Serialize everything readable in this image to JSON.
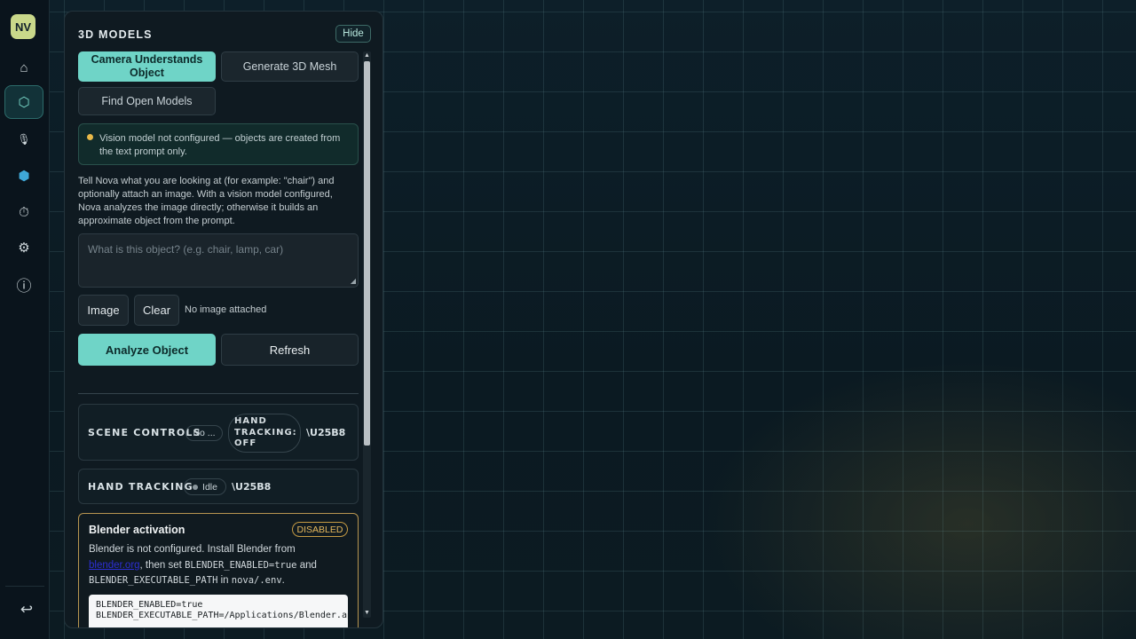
{
  "sidebar": {
    "logo": "NV",
    "items": [
      {
        "icon": "home-icon",
        "glyph": "⌂"
      },
      {
        "icon": "models-hexagon-icon",
        "glyph": "⬡"
      },
      {
        "icon": "microphone-icon",
        "glyph": "🎙"
      },
      {
        "icon": "cube-icon",
        "glyph": "⬢"
      },
      {
        "icon": "timer-icon",
        "glyph": "⏱"
      },
      {
        "icon": "gear-icon",
        "glyph": "⚙"
      },
      {
        "icon": "info-icon",
        "glyph": "ⓘ"
      }
    ],
    "exit_glyph": "↩"
  },
  "panel": {
    "title": "3D MODELS",
    "hide_label": "Hide",
    "tabs": {
      "camera": "Camera Understands Object",
      "generate": "Generate 3D Mesh",
      "find": "Find Open Models"
    },
    "notice": "Vision model not configured — objects are created from the text prompt only.",
    "description": "Tell Nova what you are looking at (for example: \"chair\") and optionally attach an image. With a vision model configured, Nova analyzes the image directly; otherwise it builds an approximate object from the prompt.",
    "prompt_placeholder": "What is this object? (e.g. chair, lamp, car)",
    "image_label": "Image",
    "clear_label": "Clear",
    "image_status": "No image attached",
    "analyze_label": "Analyze Object",
    "refresh_label": "Refresh",
    "scene_controls": {
      "title": "SCENE CONTROLS",
      "pill": "No ...",
      "hand_tracking_pill": [
        "HAND",
        "TRACKING:",
        "OFF"
      ],
      "chevron": "\\U25B8"
    },
    "hand_tracking": {
      "title": "HAND TRACKING",
      "status": "Idle",
      "chevron": "\\U25B8"
    },
    "blender": {
      "title": "Blender activation",
      "badge": "DISABLED",
      "text_1": "Blender is not configured. Install Blender from ",
      "link": "blender.org",
      "text_2": ", then set ",
      "code_1": "BLENDER_ENABLED=true",
      "text_3": " and ",
      "code_2": "BLENDER_EXECUTABLE_PATH",
      "text_4": " in ",
      "code_3": "nova/.env",
      "text_5": ".",
      "code_lines": [
        "BLENDER_ENABLED=true",
        "BLENDER_EXECUTABLE_PATH=/Applications/Blender.app/Contents/MacOS/Blender"
      ]
    }
  },
  "colors": {
    "accent": "#6fd4c7",
    "warning": "#e9b949",
    "background": "#0b1a22"
  }
}
